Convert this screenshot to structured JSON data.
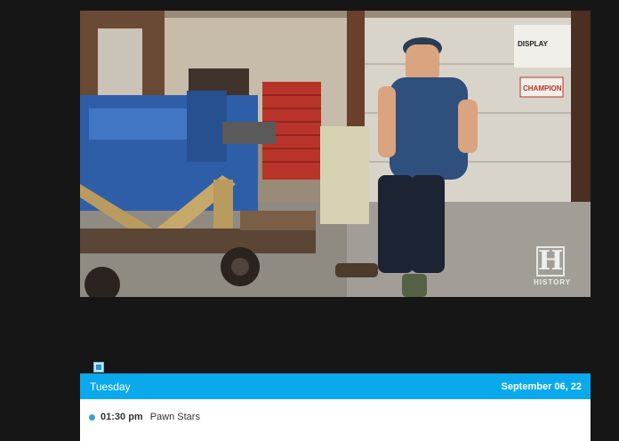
{
  "video": {
    "watermark_letter": "H",
    "watermark_text": "HISTORY",
    "icon": "history-channel-logo",
    "signs": [
      "CHAMPION",
      "DISPLAY"
    ]
  },
  "schedule": {
    "day": "Tuesday",
    "date": "September 06, 22",
    "items": [
      {
        "time": "01:30 pm",
        "title": "Pawn Stars"
      }
    ],
    "accent_color": "#0aa9ec"
  },
  "icons": {
    "small_icon": "broken-image-icon"
  }
}
